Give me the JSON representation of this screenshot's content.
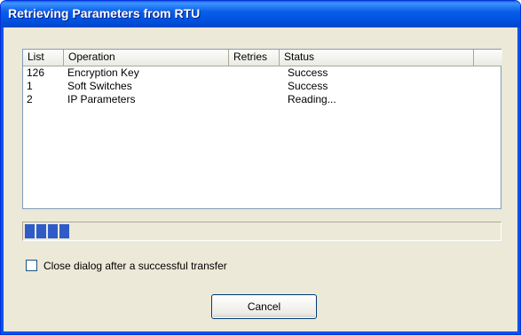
{
  "window": {
    "title": "Retrieving Parameters from RTU"
  },
  "list": {
    "columns": [
      "List",
      "Operation",
      "Retries",
      "Status"
    ],
    "rows": [
      {
        "list": "126",
        "operation": "Encryption Key",
        "retries": "",
        "status": "Success"
      },
      {
        "list": "1",
        "operation": "Soft Switches",
        "retries": "",
        "status": "Success"
      },
      {
        "list": "2",
        "operation": "IP Parameters",
        "retries": "",
        "status": "Reading..."
      }
    ]
  },
  "progress": {
    "segments_filled": 4,
    "bar_color": "#2F5BC8"
  },
  "options": {
    "close_after_transfer_label": "Close dialog after a successful transfer",
    "close_after_transfer_checked": false
  },
  "buttons": {
    "cancel_label": "Cancel"
  },
  "colors": {
    "titlebar": "#0A5FE8",
    "dialog_background": "#ECE9D8"
  }
}
